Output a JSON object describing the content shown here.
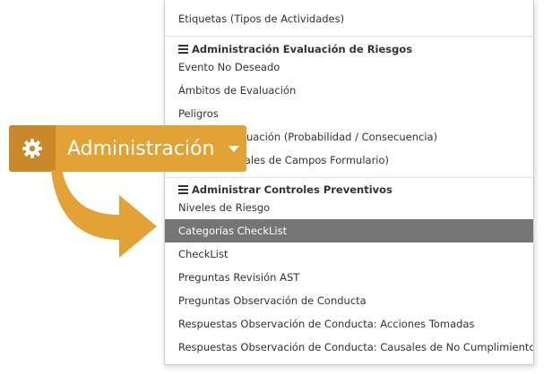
{
  "dropdown": {
    "items": [
      {
        "kind": "item",
        "label": "Etiquetas (Tipos de Actividades)"
      },
      {
        "kind": "header",
        "label": "Administración Evaluación de Riesgos"
      },
      {
        "kind": "item",
        "label": "Evento No Deseado"
      },
      {
        "kind": "item",
        "label": "Ámbitos de Evaluación"
      },
      {
        "kind": "item",
        "label": "Peligros"
      },
      {
        "kind": "item",
        "label": "Factores Evaluación (Probabilidad / Consecuencia)"
      },
      {
        "kind": "item",
        "label": "Valores Causales de Campos Formulario)"
      },
      {
        "kind": "header",
        "label": "Administrar Controles Preventivos"
      },
      {
        "kind": "item",
        "label": "Niveles de Riesgo"
      },
      {
        "kind": "item",
        "label": "Categorías CheckList",
        "active": true
      },
      {
        "kind": "item",
        "label": "CheckList"
      },
      {
        "kind": "item",
        "label": "Preguntas Revisión AST"
      },
      {
        "kind": "item",
        "label": "Preguntas Observación de Conducta"
      },
      {
        "kind": "item",
        "label": "Respuestas Observación de Conducta: Acciones Tomadas"
      },
      {
        "kind": "item",
        "label": "Respuestas Observación de Conducta: Causales de No Cumplimiento"
      }
    ]
  },
  "admin_button": {
    "label": "Administración",
    "icon": "gear-icon",
    "caret_icon": "caret-down-icon"
  },
  "colors": {
    "accent": "#e2a235",
    "accent_dark": "#c9892a",
    "active_item_bg": "#757575"
  }
}
